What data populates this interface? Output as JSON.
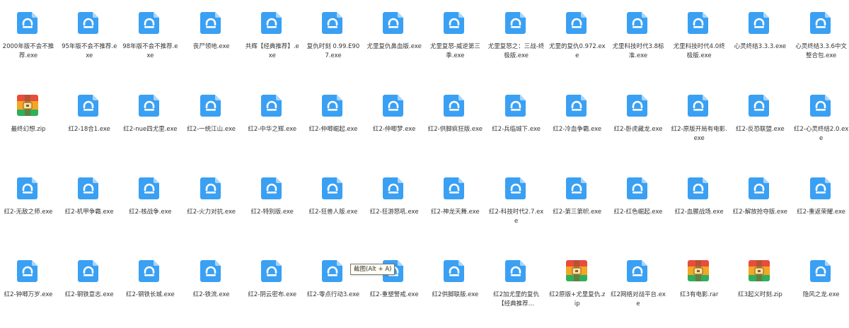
{
  "files": [
    {
      "label": "2000年版不会不推荐.exe",
      "icon": "exe-file-icon"
    },
    {
      "label": "95年版不会不推荐.exe",
      "icon": "exe-file-icon"
    },
    {
      "label": "98年版不会不推荐.exe",
      "icon": "exe-file-icon"
    },
    {
      "label": "丧尸领地.exe",
      "icon": "exe-file-icon"
    },
    {
      "label": "共辉【经典推荐】.exe",
      "icon": "exe-file-icon"
    },
    {
      "label": "复仇时刻 0.99.E907.exe",
      "icon": "exe-file-icon"
    },
    {
      "label": "尤里复仇鼻血版.exe",
      "icon": "exe-file-icon"
    },
    {
      "label": "尤里复怒-威逆第三季.exe",
      "icon": "exe-file-icon"
    },
    {
      "label": "尤里复怒之：三战-终极版.exe",
      "icon": "exe-file-icon"
    },
    {
      "label": "尤里的复仇0.972.exe",
      "icon": "exe-file-icon"
    },
    {
      "label": "尤里科技时代3.8标准.exe",
      "icon": "exe-file-icon"
    },
    {
      "label": "尤里科技时代4.0终极版.exe",
      "icon": "exe-file-icon"
    },
    {
      "label": "心灵终结3.3.3.exe",
      "icon": "exe-file-icon"
    },
    {
      "label": "心灵终结3.3.6中文整合包.exe",
      "icon": "exe-file-icon"
    },
    {
      "label": "最终幻想.zip",
      "icon": "zip-archive-icon"
    },
    {
      "label": "红2-18合1.exe",
      "icon": "exe-file-icon"
    },
    {
      "label": "红2-nue四尤里.exe",
      "icon": "exe-file-icon"
    },
    {
      "label": "红2-一统江山.exe",
      "icon": "exe-file-icon"
    },
    {
      "label": "红2-中华之辉.exe",
      "icon": "exe-file-icon"
    },
    {
      "label": "红2-仲唧崛起.exe",
      "icon": "exe-file-icon"
    },
    {
      "label": "红2-仲唧梦.exe",
      "icon": "exe-file-icon"
    },
    {
      "label": "红2-供脚疯狂版.exe",
      "icon": "exe-file-icon"
    },
    {
      "label": "红2-兵临城下.exe",
      "icon": "exe-file-icon"
    },
    {
      "label": "红2-冷血争霸.exe",
      "icon": "exe-file-icon"
    },
    {
      "label": "红2-卧虎藏龙.exe",
      "icon": "exe-file-icon"
    },
    {
      "label": "红2-原版开局有电影.exe",
      "icon": "exe-file-icon"
    },
    {
      "label": "红2-反恐联盟.exe",
      "icon": "exe-file-icon"
    },
    {
      "label": "红2-心灵终结2.0.exe",
      "icon": "exe-file-icon"
    },
    {
      "label": "红2-无敌之师.exe",
      "icon": "exe-file-icon"
    },
    {
      "label": "红2-机甲争霸.exe",
      "icon": "exe-file-icon"
    },
    {
      "label": "红2-核战争.exe",
      "icon": "exe-file-icon"
    },
    {
      "label": "红2-火力对抗.exe",
      "icon": "exe-file-icon"
    },
    {
      "label": "红2-特别版.exe",
      "icon": "exe-file-icon"
    },
    {
      "label": "红2-狂兽人版.exe",
      "icon": "exe-file-icon"
    },
    {
      "label": "红2-狂游怒吼.exe",
      "icon": "exe-file-icon"
    },
    {
      "label": "红2-神龙天舞.exe",
      "icon": "exe-file-icon"
    },
    {
      "label": "红2-科技时代2.7.exe",
      "icon": "exe-file-icon"
    },
    {
      "label": "红2-第三第帜.exe",
      "icon": "exe-file-icon"
    },
    {
      "label": "红2-红色崛起.exe",
      "icon": "exe-file-icon"
    },
    {
      "label": "红2-血腥战场.exe",
      "icon": "exe-file-icon"
    },
    {
      "label": "红2-解放抢夺版.exe",
      "icon": "exe-file-icon"
    },
    {
      "label": "红2-重返荣耀.exe",
      "icon": "exe-file-icon"
    },
    {
      "label": "红2-钟唧万岁.exe",
      "icon": "exe-file-icon"
    },
    {
      "label": "红2-钢铁意志.exe",
      "icon": "exe-file-icon"
    },
    {
      "label": "红2-钢铁长城.exe",
      "icon": "exe-file-icon"
    },
    {
      "label": "红2-铁流.exe",
      "icon": "exe-file-icon"
    },
    {
      "label": "红2-阴云密布.exe",
      "icon": "exe-file-icon"
    },
    {
      "label": "红2-零点行动3.exe",
      "icon": "exe-file-icon"
    },
    {
      "label": "红2-重塑警戒.exe",
      "icon": "exe-file-icon"
    },
    {
      "label": "红2供脚联版.exe",
      "icon": "exe-file-icon"
    },
    {
      "label": "红2加尤里的复仇【经典推荐…",
      "icon": "exe-file-icon"
    },
    {
      "label": "红2原版+尤里复仇.zip",
      "icon": "zip-archive-icon"
    },
    {
      "label": "红2网络对战平台.exe",
      "icon": "exe-file-icon"
    },
    {
      "label": "红3有电影.rar",
      "icon": "rar-archive-icon"
    },
    {
      "label": "红3起义时刻.zip",
      "icon": "zip-archive-icon"
    },
    {
      "label": "隐风之龙.exe",
      "icon": "exe-file-icon"
    }
  ],
  "tooltip": {
    "text": "截图(Alt + A)"
  },
  "colors": {
    "exe_blue": "#3aa0f3",
    "exe_fold": "#a9d6fb",
    "zip_top": "#e84c3d",
    "zip_mid": "#f5a623",
    "zip_bottom": "#2eaf5b"
  }
}
